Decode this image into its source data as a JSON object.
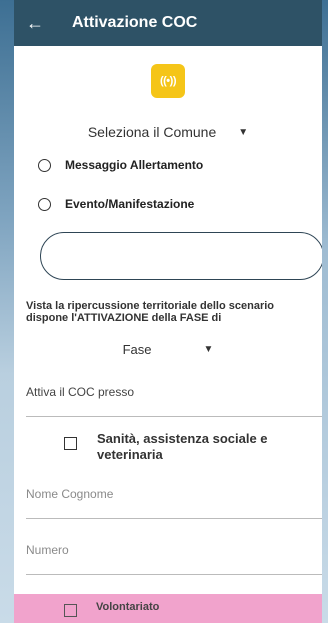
{
  "appbar": {
    "back_icon": "←",
    "title": "Attivazione COC"
  },
  "logo": {
    "icon": "broadcast-icon",
    "glyph": "((•))",
    "color": "#f5c518"
  },
  "comune_select": {
    "label": "Seleziona il Comune",
    "caret": "▼"
  },
  "radios": [
    {
      "label": "Messaggio Allertamento"
    },
    {
      "label": "Evento/Manifestazione"
    }
  ],
  "description": "Vista la ripercussione territoriale dello scenario dispone l'ATTIVAZIONE della FASE di",
  "fase_select": {
    "label": "Fase",
    "caret": "▼"
  },
  "coc_field": {
    "label": "Attiva il COC presso"
  },
  "checkbox_sanita": {
    "label": "Sanità, assistenza sociale e veterinaria"
  },
  "nome_field": {
    "placeholder": "Nome Cognome"
  },
  "numero_field": {
    "placeholder": "Numero"
  },
  "checkbox_volontariato": {
    "label": "Volontariato"
  },
  "colors": {
    "appbar": "#2e5266",
    "accent_yellow": "#f5c518",
    "bottom_bar": "#f1a3cc"
  }
}
